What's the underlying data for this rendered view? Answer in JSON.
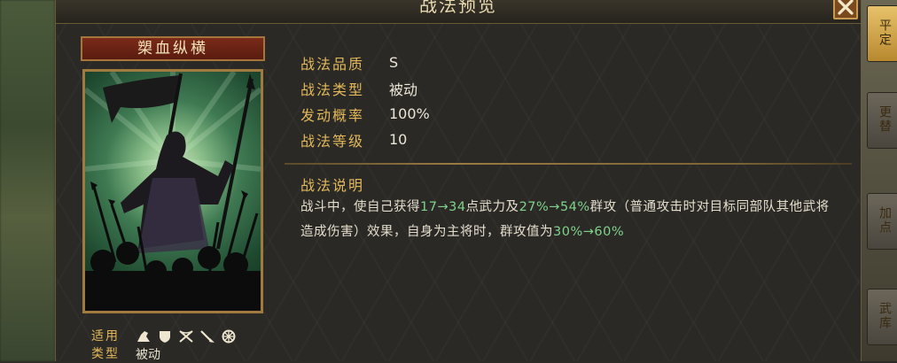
{
  "modal": {
    "title": "战法预览"
  },
  "skill": {
    "name": "槊血纵横",
    "stats": [
      {
        "label": "战法品质",
        "value": "S"
      },
      {
        "label": "战法类型",
        "value": "被动"
      },
      {
        "label": "发动概率",
        "value": "100%"
      },
      {
        "label": "战法等级",
        "value": "10"
      }
    ],
    "description_title": "战法说明",
    "description": {
      "p1": "战斗中，使自己获得",
      "h1": "17→34",
      "p2": "点武力及",
      "h2": "27%→54%",
      "p3": "群攻（普通攻击时对目标同部队其他武将造成伤害）效果，自身为主将时，群攻值为",
      "h3": "30%→60%"
    },
    "applicable_label": "适用类型",
    "applicable_value": "被动",
    "unit_icons": [
      "cavalry-icon",
      "shield-icon",
      "archer-icon",
      "spear-icon",
      "siege-icon"
    ]
  },
  "side_tabs": [
    "平定",
    "更替",
    "加点",
    "武库"
  ],
  "colors": {
    "label_gold": "#e2b85a",
    "highlight_green": "#7fd38a",
    "banner_red": "#7a2a18"
  }
}
